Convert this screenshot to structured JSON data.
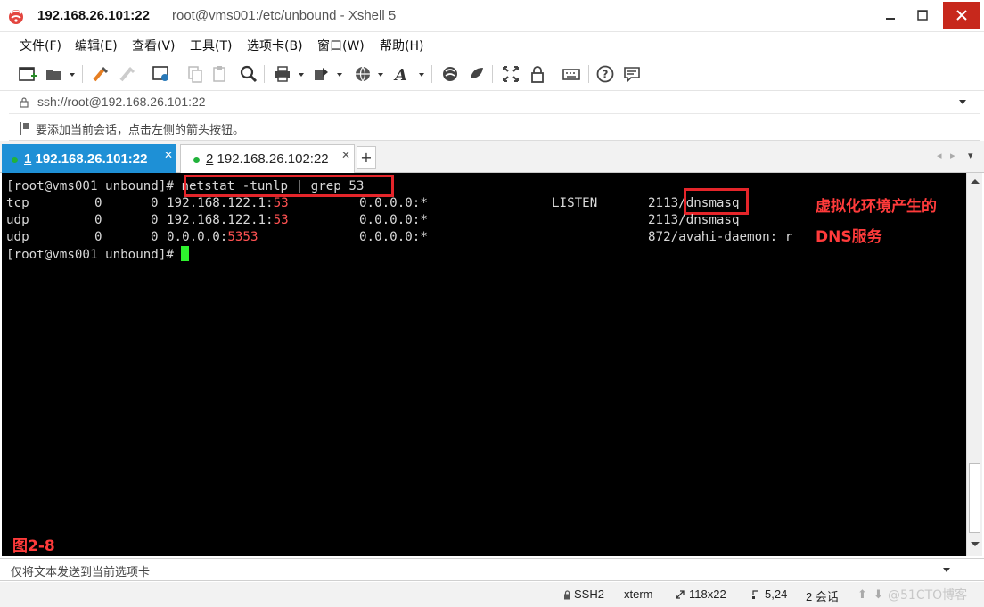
{
  "window": {
    "title_main": "192.168.26.101:22",
    "title_sub": "root@vms001:/etc/unbound - Xshell 5"
  },
  "menu": {
    "items": [
      "文件(F)",
      "编辑(E)",
      "查看(V)",
      "工具(T)",
      "选项卡(B)",
      "窗口(W)",
      "帮助(H)"
    ]
  },
  "address": {
    "url": "ssh://root@192.168.26.101:22"
  },
  "hint": {
    "text": "要添加当前会话，点击左侧的箭头按钮。"
  },
  "tabs": [
    {
      "num": "1",
      "label": "192.168.26.101:22",
      "active": true
    },
    {
      "num": "2",
      "label": "192.168.26.102:22",
      "active": false
    }
  ],
  "terminal": {
    "prompt1": "[root@vms001 unbound]# ",
    "command1": "netstat -tunlp | grep 53",
    "rows": [
      {
        "proto": "tcp",
        "recv": "0",
        "send": "0",
        "local_addr": "192.168.122.1:",
        "local_port": "53",
        "foreign": "0.0.0.0:*",
        "state": "LISTEN",
        "pid": "2113/",
        "prog": "dnsmasq"
      },
      {
        "proto": "udp",
        "recv": "0",
        "send": "0",
        "local_addr": "192.168.122.1:",
        "local_port": "53",
        "foreign": "0.0.0.0:*",
        "state": "",
        "pid": "2113/",
        "prog": "dnsmasq"
      },
      {
        "proto": "udp",
        "recv": "0",
        "send": "0",
        "local_addr": "0.0.0.0:",
        "local_port": "5353",
        "foreign": "0.0.0.0:*",
        "state": "",
        "pid": "872/",
        "prog": "avahi-daemon: r"
      }
    ],
    "prompt2": "[root@vms001 unbound]# ",
    "annotation_line1": "虚拟化环境产生的",
    "annotation_line2": "DNS服务",
    "figure_label": "图2-8"
  },
  "sendbar": {
    "placeholder": "仅将文本发送到当前选项卡"
  },
  "status": {
    "protocol": "SSH2",
    "term_type": "xterm",
    "size": "118x22",
    "cursor_pos": "5,24",
    "sessions": "2 会话",
    "watermark": "@51CTO博客"
  },
  "colors": {
    "accent_tab": "#1e90d6",
    "highlight_red": "#e5252a",
    "cursor_green": "#2ef32e",
    "close_button": "#c7281c"
  }
}
